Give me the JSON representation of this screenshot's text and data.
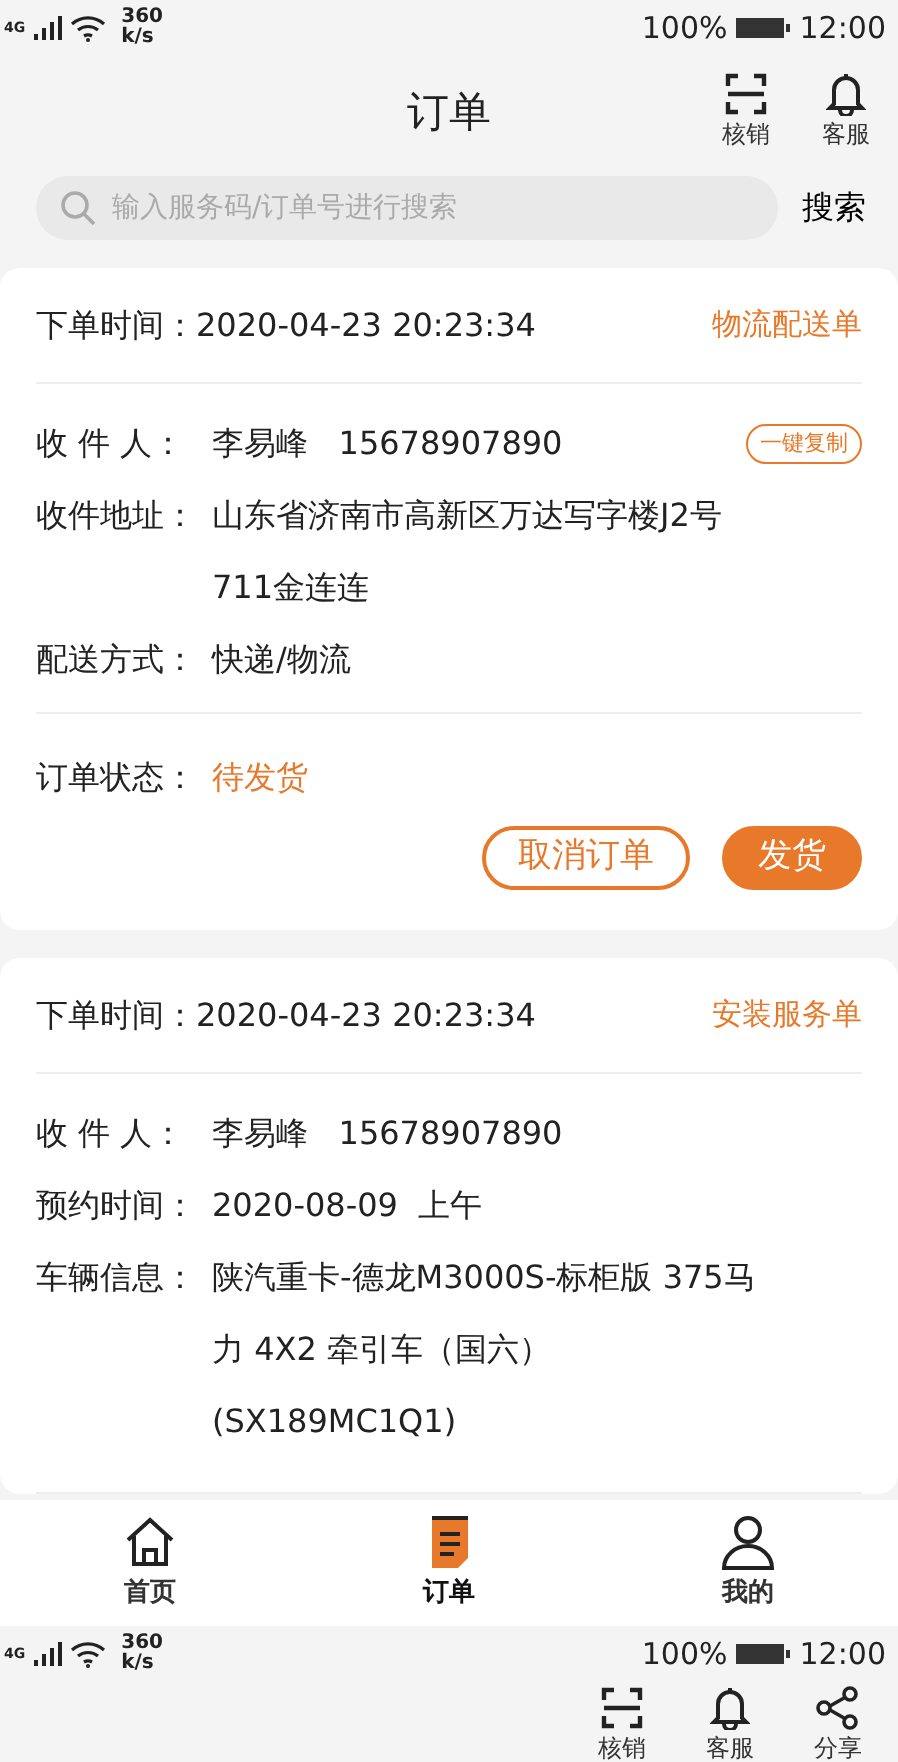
{
  "status_bar": {
    "network": "4G",
    "speed": "360",
    "speed_unit": "k/s",
    "battery": "100%",
    "time": "12:00"
  },
  "header": {
    "title": "订单",
    "actions": [
      {
        "label": "核销",
        "kind": "scan"
      },
      {
        "label": "客服",
        "kind": "bell"
      }
    ]
  },
  "search": {
    "placeholder": "输入服务码/订单号进行搜索",
    "button": "搜索"
  },
  "orders": [
    {
      "time_label": "下单时间：",
      "time": "2020-04-23  20:23:34",
      "type": "物流配送单",
      "rows": [
        {
          "label": "收 件 人：",
          "value": "李易峰   15678907890",
          "action": "一键复制"
        },
        {
          "label": "收件地址：",
          "value": "山东省济南市高新区万达写字楼J2号711金连连"
        },
        {
          "label": "配送方式：",
          "value": "快递/物流"
        }
      ],
      "status_label": "订单状态：",
      "status": "待发货",
      "buttons": [
        {
          "label": "取消订单",
          "kind": "outline"
        },
        {
          "label": "发货",
          "kind": "filled"
        }
      ]
    },
    {
      "time_label": "下单时间：",
      "time": "2020-04-23  20:23:34",
      "type": "安装服务单",
      "rows": [
        {
          "label": "收 件 人：",
          "value": "李易峰   15678907890"
        },
        {
          "label": "预约时间：",
          "value": "2020-08-09  上午"
        },
        {
          "label": "车辆信息：",
          "value": "陕汽重卡-德龙M3000S-标柜版 375马力 4X2 牵引车（国六）(SX189MC1Q1)"
        }
      ]
    }
  ],
  "tab_bar": [
    {
      "label": "首页",
      "kind": "home",
      "selected": false
    },
    {
      "label": "订单",
      "kind": "orders",
      "selected": true
    },
    {
      "label": "我的",
      "kind": "profile",
      "selected": false
    }
  ],
  "next_screen": {
    "status_bar": {
      "network": "4G",
      "speed": "360",
      "speed_unit": "k/s",
      "battery": "100%",
      "time": "12:00"
    },
    "actions": [
      {
        "label": "核销",
        "kind": "scan"
      },
      {
        "label": "客服",
        "kind": "bell"
      },
      {
        "label": "分享",
        "kind": "share"
      }
    ]
  }
}
